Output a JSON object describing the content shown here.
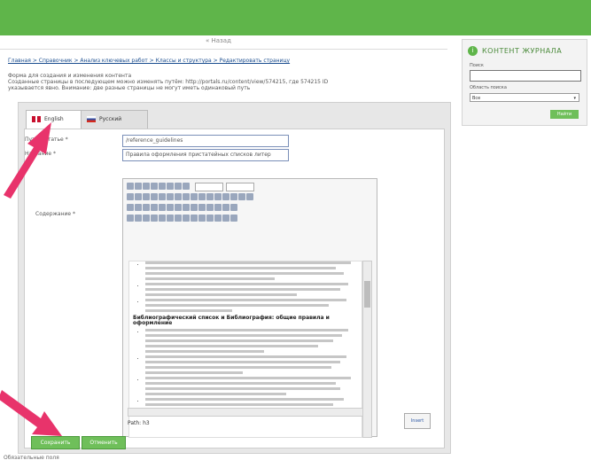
{
  "header": {
    "back_link": "« Назад"
  },
  "breadcrumb": {
    "text": "Главная > Справочник > Анализ ключевых работ > Классы и структура > Редактировать страницу"
  },
  "help": {
    "line1": "Форма для создания и изменения контента",
    "line2": "Созданные страницы в последующем можно изменять путём: http://portals.ru/content/view/574215, где 574215 ID",
    "line3": "указывается явно. Внимание: две разные страницы не могут иметь одинаковый путь"
  },
  "tabs": [
    {
      "label": "English"
    },
    {
      "label": "Русский"
    }
  ],
  "form": {
    "path_label": "Путь к статье *",
    "path_value": "/reference_guidelines",
    "title_label": "Название *",
    "title_value": "Правила оформления пристатейных списков литер",
    "content_label": "Содержание *",
    "content_heading": "Библиографический список и Библиография: общие правила и оформление",
    "status_path": "Path: h3",
    "insert_button": "Insert",
    "save_button": "Сохранить",
    "cancel_button": "Отменить"
  },
  "footer": {
    "note": "Обязательные поля"
  },
  "sidebar": {
    "title": "КОНТЕНТ ЖУРНАЛА",
    "search_label": "Поиск",
    "filter_label": "Область поиска",
    "filter_value": "Все",
    "find_button": "Найти"
  }
}
